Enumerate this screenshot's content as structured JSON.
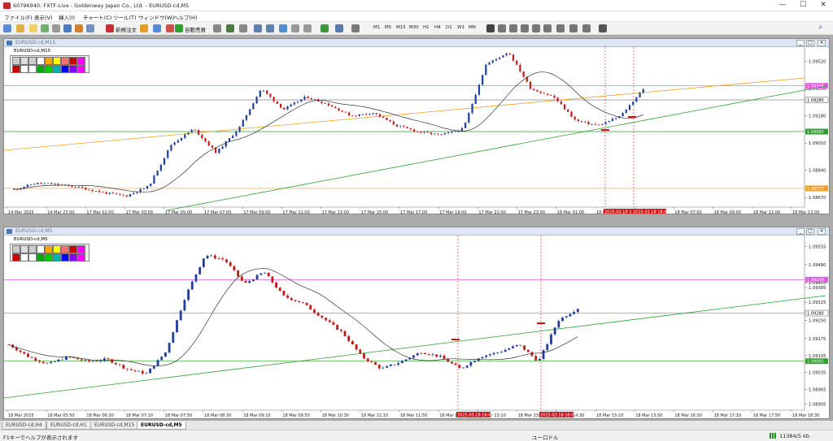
{
  "window": {
    "title": "60796940: FXTF-Live - Goldenway Japan Co., Ltd. - EURUSD-cd,M5",
    "min": "—",
    "max": "☐",
    "close": "✕"
  },
  "menu": [
    "ファイル(F)",
    "表示(V)",
    "挿入(I)",
    "チャート(C)",
    "ツール(T)",
    "ウィンドウ(W)",
    "ヘルプ(H)"
  ],
  "toolbar": {
    "new_order": "新規注文",
    "auto_trade": "自動売買",
    "timeframes": [
      "M1",
      "M5",
      "M15",
      "M30",
      "H1",
      "H4",
      "D1",
      "W1",
      "MN"
    ],
    "search": "⌕"
  },
  "colors": {
    "bull": "#1f3d9a",
    "bear": "#c41818",
    "ma": "#333333",
    "orange": "#f0a020",
    "green": "#2e9e2e",
    "magenta": "#e05ae0",
    "gray": "#888888",
    "red_tag": "#d81010"
  },
  "top_chart": {
    "window_title": "EURUSD-cd,M15",
    "symbol": "EURUSD-cd,M15",
    "price_labels": [
      "1.09520",
      "1.09350",
      "1.09180",
      "1.09010",
      "1.08840",
      "1.08670"
    ],
    "tagged_prices": {
      "magenta": "1.09368",
      "gray": "1.09280",
      "green": "1.09082",
      "orange": "1.08727"
    },
    "time_labels": [
      "14 Mar 2025",
      "14 Mar 23:00",
      "17 Mar 01:00",
      "17 Mar 03:00",
      "17 Mar 05:00",
      "17 Mar 07:00",
      "17 Mar 09:00",
      "17 Mar 11:00",
      "17 Mar 13:00",
      "17 Mar 15:00",
      "17 Mar 17:00",
      "17 Mar 19:00",
      "17 Mar 21:00",
      "17 Mar 23:00",
      "18 Mar 01:00",
      "18 Mar 03:00",
      "18 Mar 05:00",
      "18 Mar 07:00",
      "18 Mar 09:00",
      "18 Mar 11:00",
      "18 Mar 13:00"
    ],
    "red_time_tags": [
      "2025.03.18 16:",
      "2025.03.18 18:00"
    ]
  },
  "bottom_chart": {
    "window_title": "EURUSD-cd,M5",
    "symbol": "EURUSD-cd,M5",
    "price_labels": [
      "1.09555",
      "1.09480",
      "1.09405",
      "1.09385",
      "1.09325",
      "1.09250",
      "1.09175",
      "1.09105",
      "1.09035",
      "1.08965",
      "1.08905"
    ],
    "tagged_prices": {
      "magenta": "1.09418",
      "gray": "1.09280",
      "green": "1.09082"
    },
    "time_labels": [
      "18 Mar 2025",
      "18 Mar 05:50",
      "18 Mar 06:30",
      "18 Mar 07:10",
      "18 Mar 07:50",
      "18 Mar 08:30",
      "18 Mar 09:10",
      "18 Mar 09:50",
      "18 Mar 10:30",
      "18 Mar 11:10",
      "18 Mar 11:50",
      "18 Mar 12:30",
      "18 Mar 13:10",
      "18 Mar 13:50",
      "18 Mar 14:30",
      "18 Mar 15:10",
      "18 Mar 15:50",
      "18 Mar 16:30",
      "18 Mar 17:10",
      "18 Mar 17:50",
      "18 Mar 18:30"
    ],
    "red_time_tags": [
      "2025.03.18 16:00",
      "2025.03.18 18:00"
    ]
  },
  "tabs": [
    "EURUSD-cd,H4",
    "EURUSD-cd,H1",
    "EURUSD-cd,M15",
    "EURUSD-cd,M5"
  ],
  "active_tab": "EURUSD-cd,M5",
  "status": {
    "help": "F1キーでヘルプが表示されます",
    "symbol": "ユーロドル",
    "traffic": "11384/5 kb"
  }
}
